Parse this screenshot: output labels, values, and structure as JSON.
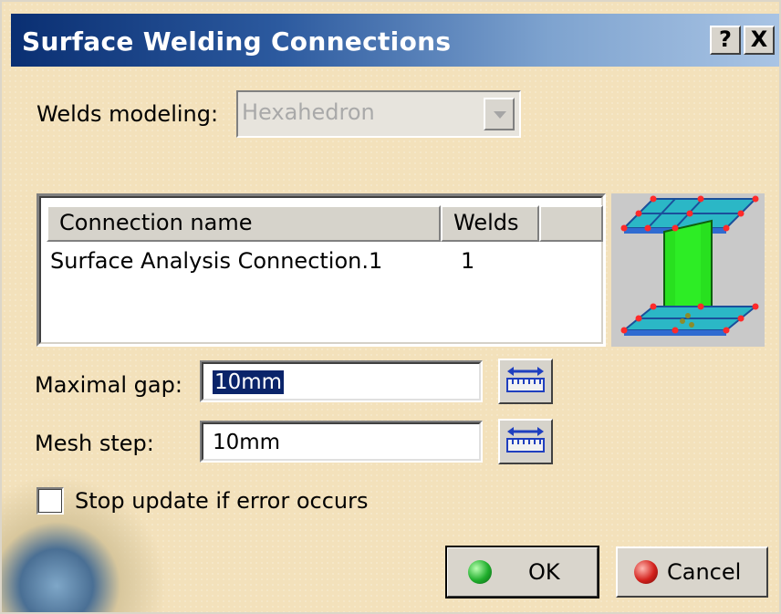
{
  "dialog": {
    "title": "Surface Welding Connections",
    "help_button": "?",
    "close_button": "X"
  },
  "welds_modeling": {
    "label": "Welds modeling:",
    "value": "Hexahedron",
    "enabled": false
  },
  "table": {
    "columns": [
      "Connection name",
      "Welds"
    ],
    "rows": [
      {
        "name": "Surface Analysis Connection.1",
        "welds": "1"
      }
    ]
  },
  "maximal_gap": {
    "label": "Maximal gap:",
    "value": "10mm"
  },
  "mesh_step": {
    "label": "Mesh step:",
    "value": "10mm"
  },
  "stop_update": {
    "label": "Stop update if error occurs",
    "checked": false
  },
  "buttons": {
    "ok": "OK",
    "cancel": "Cancel"
  },
  "colors": {
    "title_gradient_start": "#0a2f72",
    "dialog_background": "#f3e1bb",
    "ok_indicator": "#1fae2c",
    "cancel_indicator": "#d3211c"
  },
  "icons": {
    "measure": "measure-ruler-icon",
    "ok": "green-ball-icon",
    "cancel": "red-ball-icon",
    "preview": "i-beam-weld-preview-icon"
  }
}
